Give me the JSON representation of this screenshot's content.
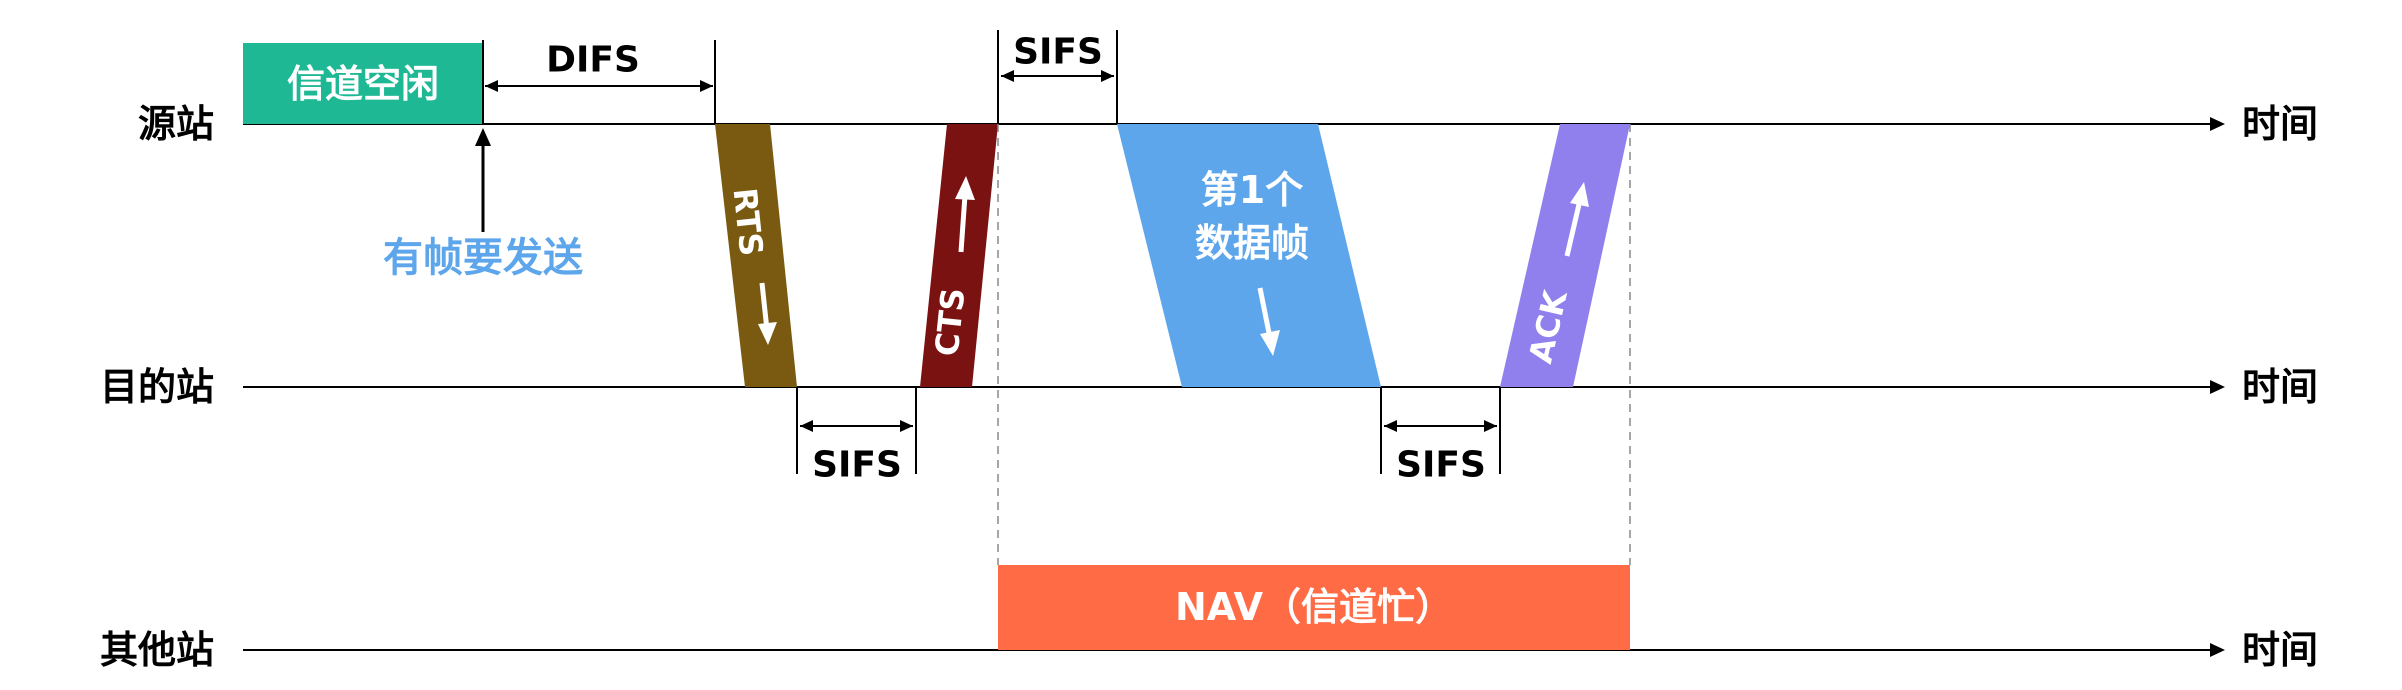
{
  "rows": {
    "source": "源站",
    "destination": "目的站",
    "others": "其他站"
  },
  "time_label": "时间",
  "channel_idle": "信道空闲",
  "frame_to_send": "有帧要发送",
  "intervals": {
    "difs": "DIFS",
    "sifs": "SIFS"
  },
  "frames": {
    "rts": "RTS",
    "cts": "CTS",
    "data_line1": "第1个",
    "data_line2": "数据帧",
    "ack": "ACK"
  },
  "nav": "NAV（信道忙）",
  "colors": {
    "idle": "#1fb894",
    "rts": "#7a5a10",
    "cts": "#7b1212",
    "data": "#5ea6ec",
    "ack": "#9080ee",
    "nav": "#ff6b45",
    "frame_to_send_text": "#5ea6ec"
  }
}
